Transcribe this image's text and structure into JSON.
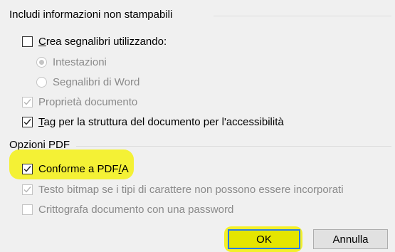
{
  "include_section": {
    "title": "Includi informazioni non stampabili",
    "create_bookmarks": {
      "label_u": "C",
      "label_rest": "rea segnalibri utilizzando:",
      "checked": false,
      "enabled": true
    },
    "headings_radio": {
      "label": "Intestazioni",
      "checked": true,
      "enabled": false
    },
    "word_bookmarks_radio": {
      "label": "Segnalibri di Word",
      "checked": false,
      "enabled": false
    },
    "doc_properties": {
      "label": "Proprietà documento",
      "checked": true,
      "enabled": false
    },
    "structure_tags": {
      "label_u": "T",
      "label_rest": "ag per la struttura del documento per l'accessibilità",
      "checked": true,
      "enabled": true
    }
  },
  "pdf_section": {
    "title": "Opzioni PDF",
    "pdfa": {
      "label_pre": "Conforme a PDF",
      "label_u": "/",
      "label_post": "A",
      "checked": true,
      "enabled": true
    },
    "bitmap_text": {
      "label": "Testo bitmap se i tipi di carattere non possono essere incorporati",
      "checked": true,
      "enabled": false
    },
    "encrypt": {
      "label": "Crittografa documento con una password",
      "checked": false,
      "enabled": false
    }
  },
  "buttons": {
    "ok": "OK",
    "cancel": "Annulla"
  },
  "colors": {
    "highlight": "#f3f02a",
    "focus_border": "#2a7be4"
  }
}
